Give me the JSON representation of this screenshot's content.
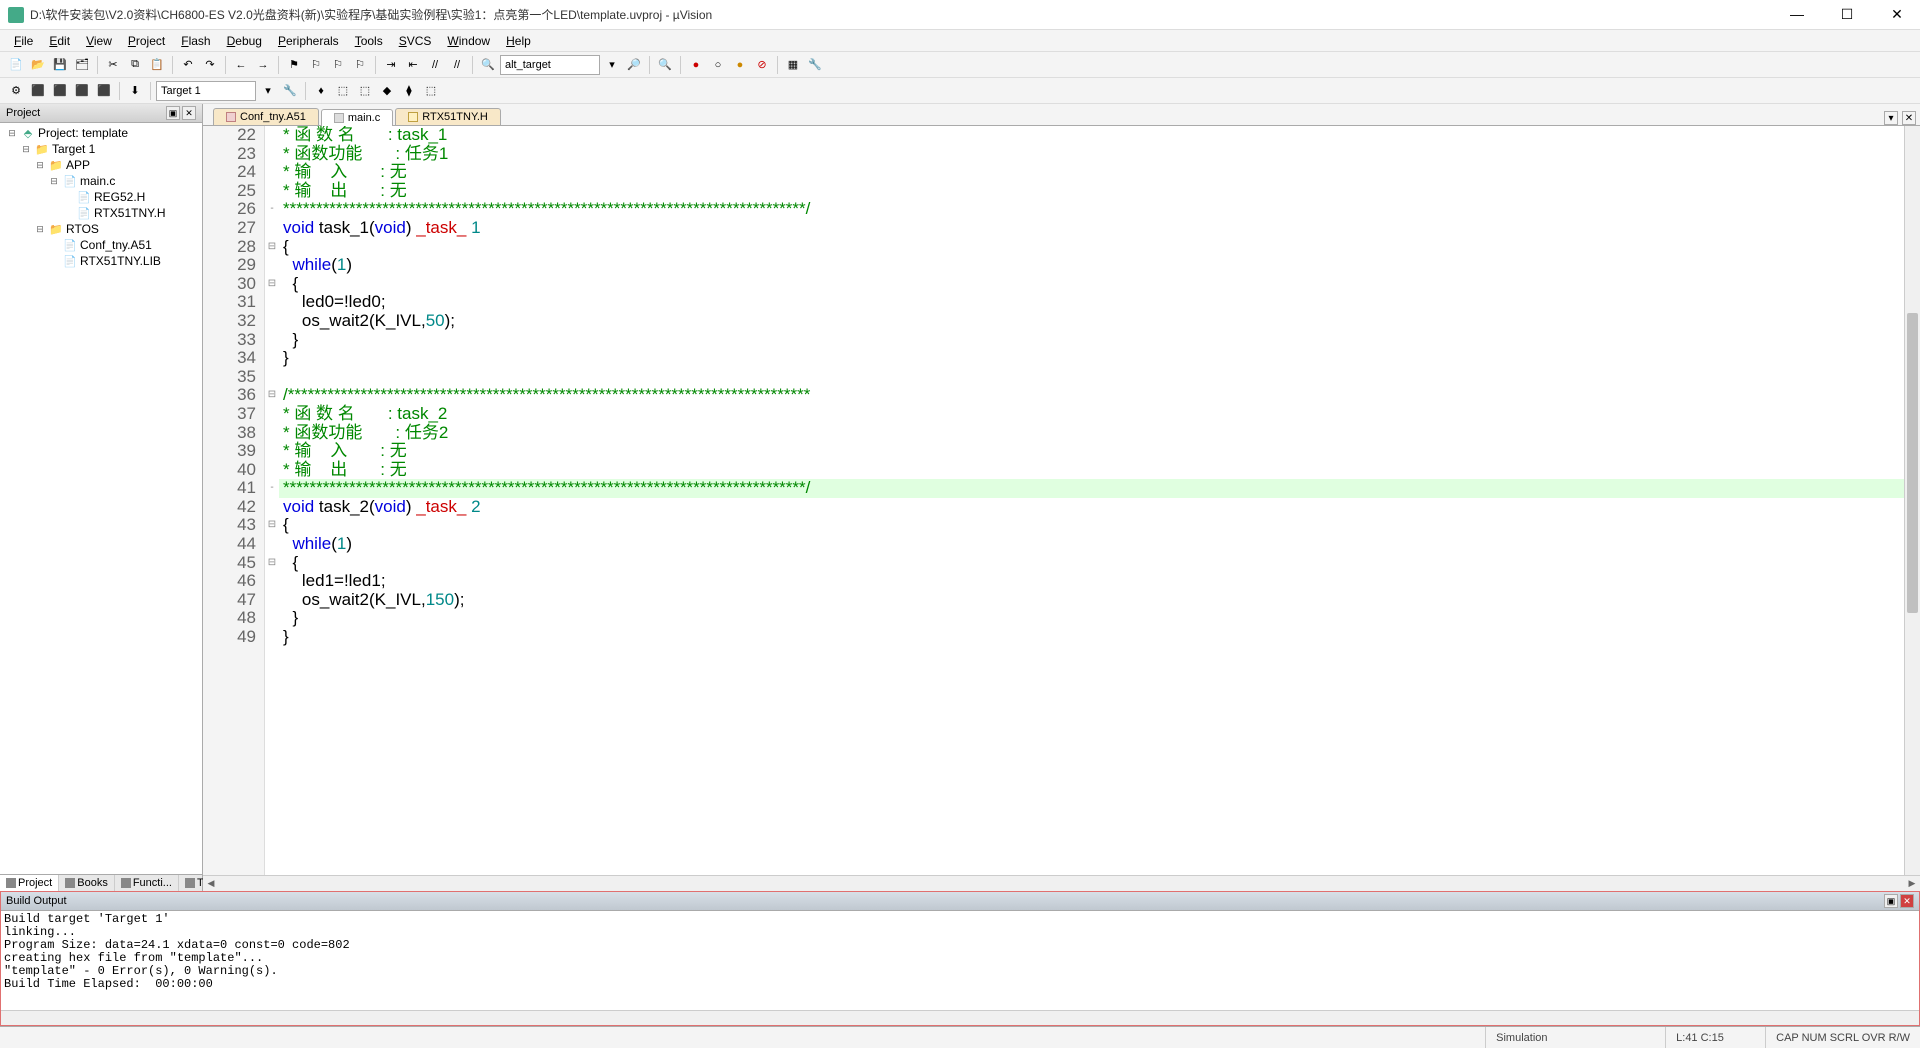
{
  "title": "D:\\软件安装包\\V2.0资料\\CH6800-ES V2.0光盘资料(新)\\实验程序\\基础实验例程\\实验1：点亮第一个LED\\template.uvproj - µVision",
  "menu": [
    "File",
    "Edit",
    "View",
    "Project",
    "Flash",
    "Debug",
    "Peripherals",
    "Tools",
    "SVCS",
    "Window",
    "Help"
  ],
  "toolbar1": {
    "altTarget": "alt_target"
  },
  "toolbar2": {
    "target": "Target 1"
  },
  "projectPanel": {
    "title": "Project",
    "root": "Project: template",
    "target": "Target 1",
    "groups": [
      {
        "name": "APP",
        "files": [
          "main.c",
          "REG52.H",
          "RTX51TNY.H"
        ],
        "expanded": true,
        "fileExpanded": true
      },
      {
        "name": "RTOS",
        "files": [
          "Conf_tny.A51",
          "RTX51TNY.LIB"
        ],
        "expanded": true
      }
    ],
    "tabs": [
      "Project",
      "Books",
      "Functi...",
      "Templ..."
    ]
  },
  "editor": {
    "tabs": [
      {
        "label": "Conf_tny.A51",
        "active": false,
        "kind": "a",
        "modified": true
      },
      {
        "label": "main.c",
        "active": true,
        "kind": "c"
      },
      {
        "label": "RTX51TNY.H",
        "active": false,
        "kind": "h"
      }
    ],
    "highlightLine": 41,
    "lines": [
      {
        "n": 22,
        "segs": [
          [
            "* 函 数 名       : task_1",
            "comment"
          ]
        ]
      },
      {
        "n": 23,
        "segs": [
          [
            "* 函数功能       : 任务1",
            "comment"
          ]
        ]
      },
      {
        "n": 24,
        "segs": [
          [
            "* 输    入       : 无",
            "comment"
          ]
        ]
      },
      {
        "n": 25,
        "segs": [
          [
            "* 输    出       : 无",
            "comment"
          ]
        ]
      },
      {
        "n": 26,
        "fold": "-",
        "segs": [
          [
            "*******************************************************************************/",
            "comment"
          ]
        ]
      },
      {
        "n": 27,
        "segs": [
          [
            "void ",
            "keyword"
          ],
          [
            "task_1(",
            ""
          ],
          [
            "void",
            "keyword"
          ],
          [
            ") ",
            ""
          ],
          [
            "_task_",
            "attr"
          ],
          [
            " ",
            ""
          ],
          [
            "1",
            "num"
          ]
        ]
      },
      {
        "n": 28,
        "fold": "⊟",
        "segs": [
          [
            "{",
            ""
          ]
        ]
      },
      {
        "n": 29,
        "segs": [
          [
            "  ",
            ""
          ],
          [
            "while",
            "keyword"
          ],
          [
            "(",
            ""
          ],
          [
            "1",
            "num"
          ],
          [
            ")",
            ""
          ]
        ]
      },
      {
        "n": 30,
        "fold": "⊟",
        "segs": [
          [
            "  {",
            ""
          ]
        ]
      },
      {
        "n": 31,
        "segs": [
          [
            "    led0=!led0;",
            ""
          ]
        ]
      },
      {
        "n": 32,
        "segs": [
          [
            "    os_wait2(K_IVL,",
            ""
          ],
          [
            "50",
            "num"
          ],
          [
            ");",
            ""
          ]
        ]
      },
      {
        "n": 33,
        "segs": [
          [
            "  }",
            ""
          ]
        ]
      },
      {
        "n": 34,
        "segs": [
          [
            "}",
            ""
          ]
        ]
      },
      {
        "n": 35,
        "segs": [
          [
            "",
            ""
          ]
        ]
      },
      {
        "n": 36,
        "fold": "⊟",
        "segs": [
          [
            "/*******************************************************************************",
            "comment"
          ]
        ]
      },
      {
        "n": 37,
        "segs": [
          [
            "* 函 数 名       : task_2",
            "comment"
          ]
        ]
      },
      {
        "n": 38,
        "segs": [
          [
            "* 函数功能       : 任务2",
            "comment"
          ]
        ]
      },
      {
        "n": 39,
        "segs": [
          [
            "* 输    入       : 无",
            "comment"
          ]
        ]
      },
      {
        "n": 40,
        "segs": [
          [
            "* 输    出       : 无",
            "comment"
          ]
        ]
      },
      {
        "n": 41,
        "fold": "-",
        "segs": [
          [
            "*******************************************************************************/",
            "comment"
          ]
        ]
      },
      {
        "n": 42,
        "segs": [
          [
            "void ",
            "keyword"
          ],
          [
            "task_2(",
            ""
          ],
          [
            "void",
            "keyword"
          ],
          [
            ") ",
            ""
          ],
          [
            "_task_",
            "attr"
          ],
          [
            " ",
            ""
          ],
          [
            "2",
            "num"
          ]
        ]
      },
      {
        "n": 43,
        "fold": "⊟",
        "segs": [
          [
            "{",
            ""
          ]
        ]
      },
      {
        "n": 44,
        "segs": [
          [
            "  ",
            ""
          ],
          [
            "while",
            "keyword"
          ],
          [
            "(",
            ""
          ],
          [
            "1",
            "num"
          ],
          [
            ")",
            ""
          ]
        ]
      },
      {
        "n": 45,
        "fold": "⊟",
        "segs": [
          [
            "  {",
            ""
          ]
        ]
      },
      {
        "n": 46,
        "segs": [
          [
            "    led1=!led1;",
            ""
          ]
        ]
      },
      {
        "n": 47,
        "segs": [
          [
            "    os_wait2(K_IVL,",
            ""
          ],
          [
            "150",
            "num"
          ],
          [
            ");",
            ""
          ]
        ]
      },
      {
        "n": 48,
        "segs": [
          [
            "  }",
            ""
          ]
        ]
      },
      {
        "n": 49,
        "segs": [
          [
            "}",
            ""
          ]
        ]
      }
    ]
  },
  "buildOutput": {
    "title": "Build Output",
    "text": "Build target 'Target 1'\nlinking...\nProgram Size: data=24.1 xdata=0 const=0 code=802\ncreating hex file from \"template\"...\n\"template\" - 0 Error(s), 0 Warning(s).\nBuild Time Elapsed:  00:00:00"
  },
  "statusbar": {
    "mode": "Simulation",
    "position": "L:41 C:15",
    "states": "CAP NUM SCRL OVR R/W"
  }
}
